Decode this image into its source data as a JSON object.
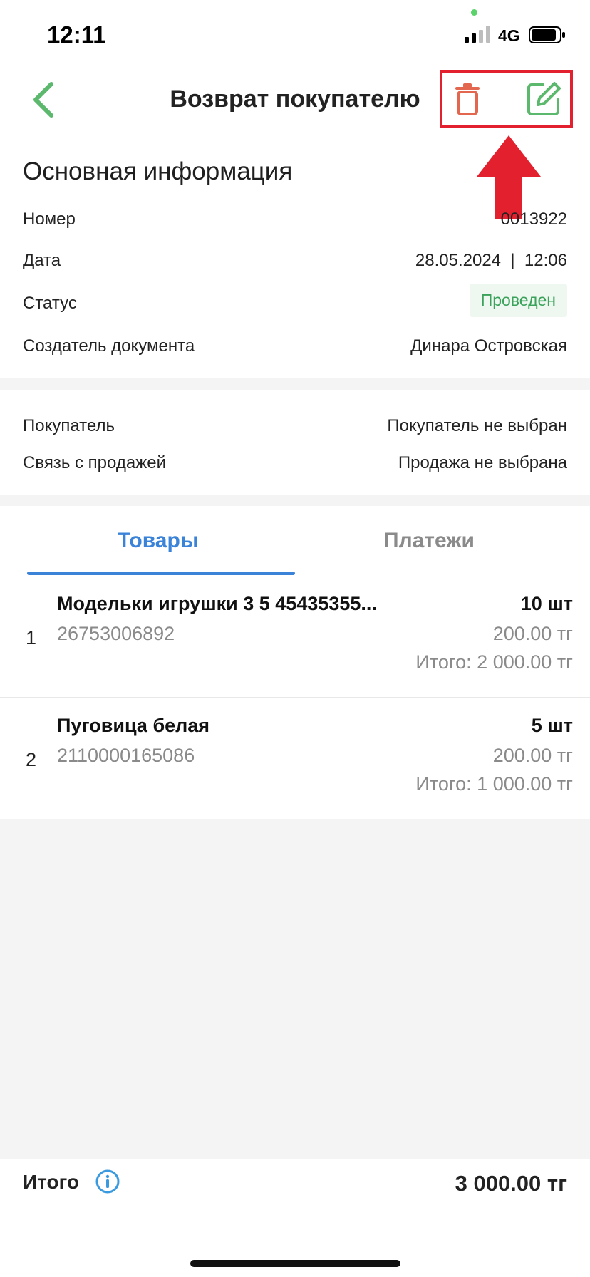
{
  "status_bar": {
    "time": "12:11",
    "network": "4G"
  },
  "header": {
    "title": "Возврат покупателю"
  },
  "main_info": {
    "title": "Основная информация",
    "rows": [
      {
        "label": "Номер",
        "value": "0013922"
      },
      {
        "label": "Дата",
        "value": "28.05.2024  |  12:06"
      },
      {
        "label": "Статус",
        "value": "Проведен"
      },
      {
        "label": "Создатель документа",
        "value": "Динара Островская"
      }
    ]
  },
  "links": {
    "rows": [
      {
        "label": "Покупатель",
        "value": "Покупатель не выбран"
      },
      {
        "label": "Связь с продажей",
        "value": "Продажа не выбрана"
      }
    ]
  },
  "tabs": [
    {
      "label": "Товары",
      "active": true
    },
    {
      "label": "Платежи",
      "active": false
    }
  ],
  "items": [
    {
      "num": "1",
      "name": "Модельки игрушки 3 5 45435355...",
      "code": "26753006892",
      "qty": "10 шт",
      "price": "200.00 тг",
      "total": "Итого: 2 000.00 тг"
    },
    {
      "num": "2",
      "name": "Пуговица белая",
      "code": "2110000165086",
      "qty": "5 шт",
      "price": "200.00 тг",
      "total": "Итого: 1 000.00 тг"
    }
  ],
  "footer": {
    "label": "Итого",
    "total": "3 000.00 тг"
  },
  "colors": {
    "accent_blue": "#3a83d8",
    "accent_green": "#5bb86c",
    "delete_red": "#e2674e",
    "highlight_red": "#e3202d",
    "status_green": "#3aa25a"
  }
}
